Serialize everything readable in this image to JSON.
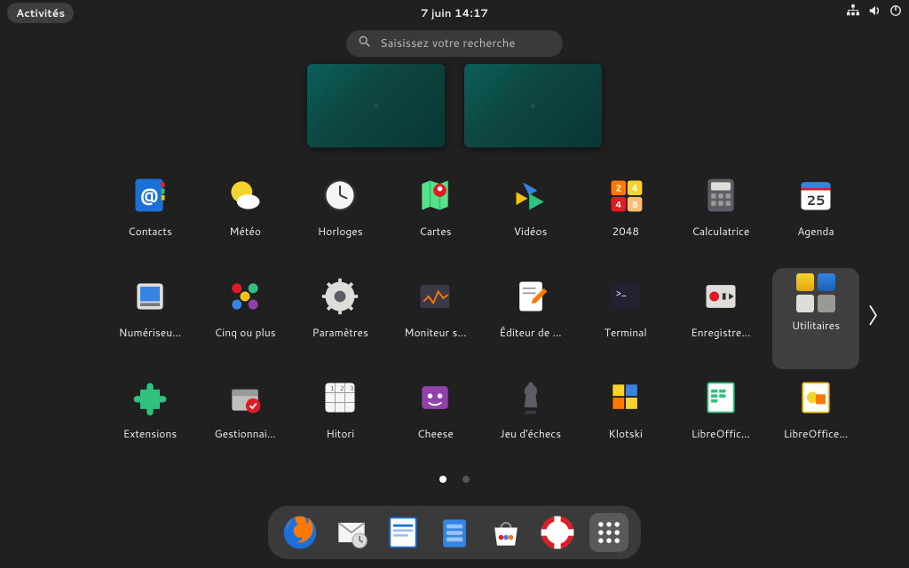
{
  "topbar": {
    "activities": "Activités",
    "datetime": "7 juin  14:17"
  },
  "search": {
    "placeholder": "Saisissez votre recherche"
  },
  "workspaces": {
    "count": 2
  },
  "page_indicator": {
    "current": 1,
    "total": 2
  },
  "apps": [
    {
      "id": "contacts",
      "label": "Contacts"
    },
    {
      "id": "weather",
      "label": "Météo"
    },
    {
      "id": "clocks",
      "label": "Horloges"
    },
    {
      "id": "maps",
      "label": "Cartes"
    },
    {
      "id": "videos",
      "label": "Vidéos"
    },
    {
      "id": "2048",
      "label": "2048"
    },
    {
      "id": "calculator",
      "label": "Calculatrice"
    },
    {
      "id": "calendar",
      "label": "Agenda"
    },
    {
      "id": "scanner",
      "label": "Numériseu…"
    },
    {
      "id": "fiveormore",
      "label": "Cinq ou plus"
    },
    {
      "id": "settings",
      "label": "Paramètres"
    },
    {
      "id": "monitor",
      "label": "Moniteur s…"
    },
    {
      "id": "editor",
      "label": "Éditeur de …"
    },
    {
      "id": "terminal",
      "label": "Terminal"
    },
    {
      "id": "recorder",
      "label": "Enregistre…"
    },
    {
      "id": "utilities",
      "label": "Utilitaires",
      "folder": true
    },
    {
      "id": "extensions",
      "label": "Extensions"
    },
    {
      "id": "software",
      "label": "Gestionnai…"
    },
    {
      "id": "hitori",
      "label": "Hitori"
    },
    {
      "id": "cheese",
      "label": "Cheese"
    },
    {
      "id": "chess",
      "label": "Jeu d'échecs"
    },
    {
      "id": "klotski",
      "label": "Klotski"
    },
    {
      "id": "lo-calc",
      "label": "LibreOffic…"
    },
    {
      "id": "lo-draw",
      "label": "LibreOffice…"
    }
  ],
  "dash": [
    {
      "id": "firefox",
      "label": "Firefox"
    },
    {
      "id": "evolution",
      "label": "Evolution"
    },
    {
      "id": "writer",
      "label": "LibreOffice Writer"
    },
    {
      "id": "files",
      "label": "Fichiers"
    },
    {
      "id": "software-center",
      "label": "Logiciels"
    },
    {
      "id": "help",
      "label": "Aide"
    },
    {
      "id": "show-apps",
      "label": "Afficher les applications"
    }
  ]
}
